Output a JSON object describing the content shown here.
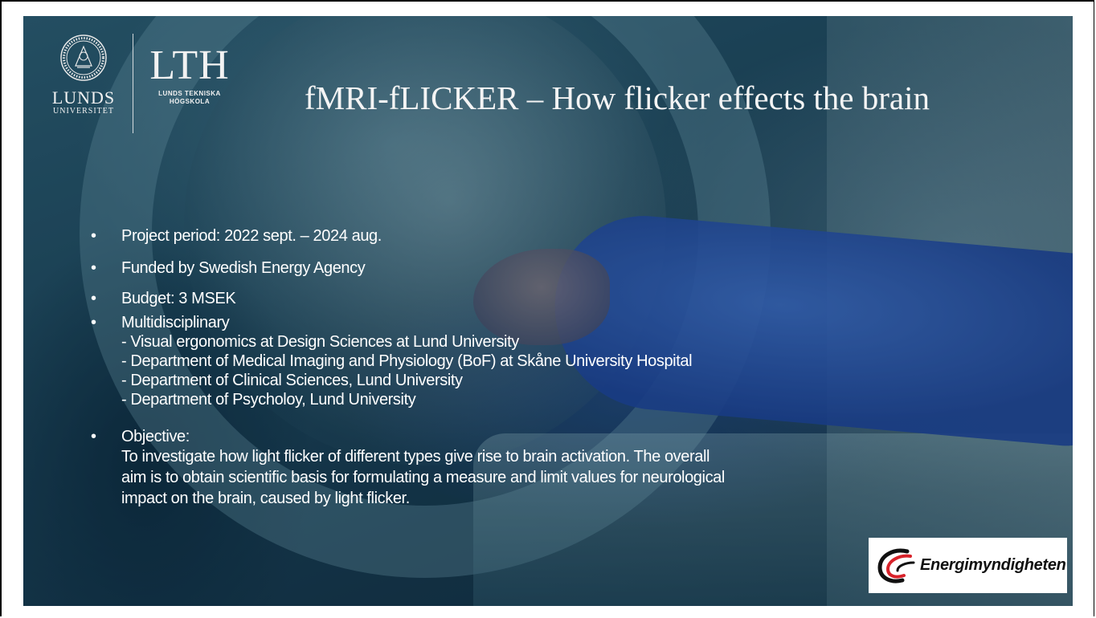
{
  "logos": {
    "lu_name": "LUNDS",
    "lu_sub": "UNIVERSITET",
    "lth_title": "LTH",
    "lth_sub_1": "LUNDS TEKNISKA",
    "lth_sub_2": "HÖGSKOLA",
    "energi_name": "Energimyndigheten"
  },
  "slide": {
    "title": "fMRI-fLICKER – How flicker effects the brain",
    "bullet_glyph": "•",
    "bullets": {
      "period": "Project period: 2022 sept. – 2024 aug.",
      "funding": "Funded by Swedish Energy Agency",
      "budget": "Budget: 3 MSEK",
      "multi": "Multidisciplinary",
      "multi_items": [
        "- Visual ergonomics at Design Sciences at Lund University",
        "- Department of Medical Imaging and Physiology (BoF) at Skåne University Hospital",
        "- Department of Clinical Sciences, Lund University",
        "- Department of Psycholoy, Lund University"
      ],
      "objective_label": "Objective:",
      "objective_lines": [
        "To investigate how light flicker of different types give rise to brain activation. The overall",
        "aim is to obtain scientific basis for formulating a measure and limit values for neurological",
        "impact on the brain, caused by light flicker."
      ]
    }
  },
  "colors": {
    "text": "#ffffff",
    "energi_red": "#d8222a",
    "energi_black": "#111111"
  }
}
